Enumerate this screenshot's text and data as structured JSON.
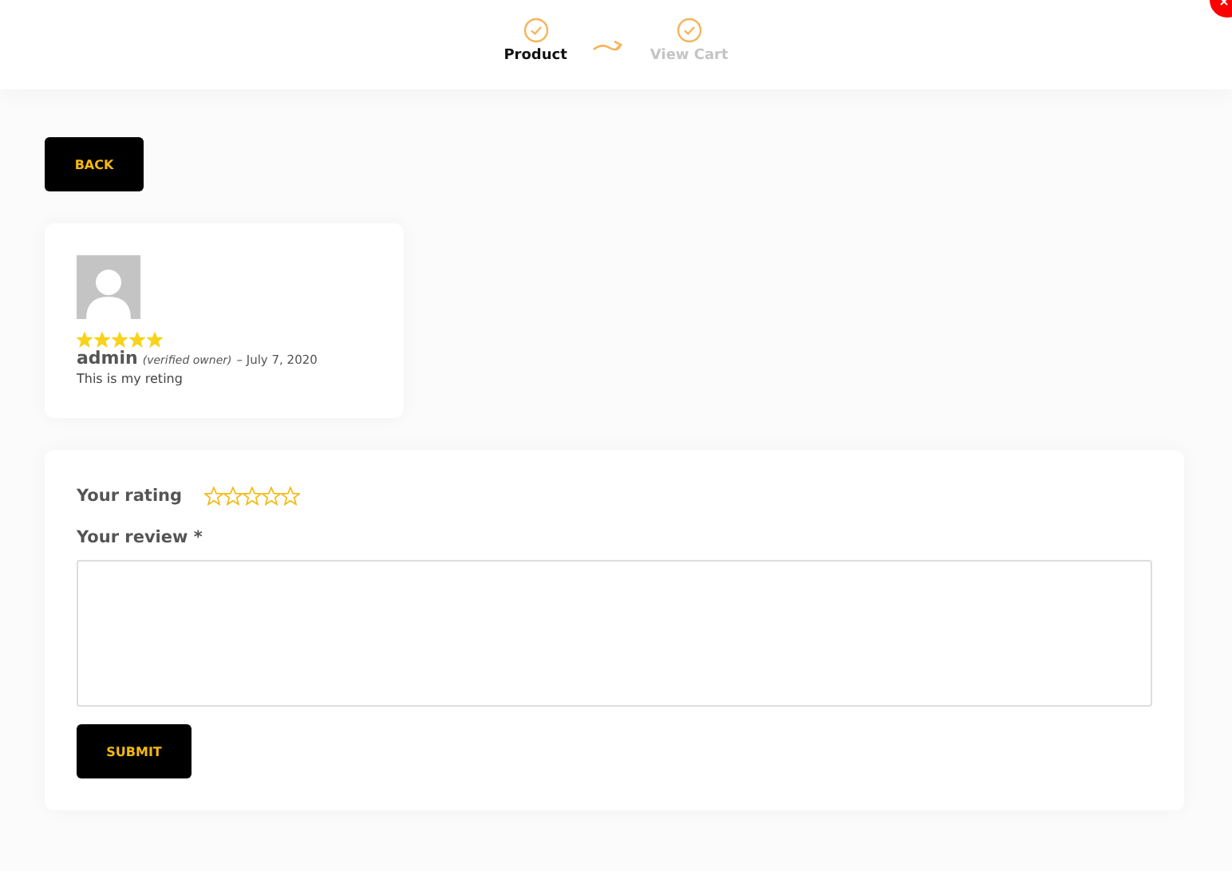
{
  "steps": [
    {
      "label": "Product",
      "selected": true
    },
    {
      "label": "View Cart",
      "selected": false
    }
  ],
  "back_button": "BACK",
  "review": {
    "stars": 5,
    "author": "admin",
    "verified": "(verified owner)",
    "date": "– July 7, 2020",
    "text": "This is my reting"
  },
  "form": {
    "rating_label": "Your rating",
    "rating": {
      "stars": 0
    },
    "review_label": "Your review *",
    "submit": "SUBMIT"
  }
}
